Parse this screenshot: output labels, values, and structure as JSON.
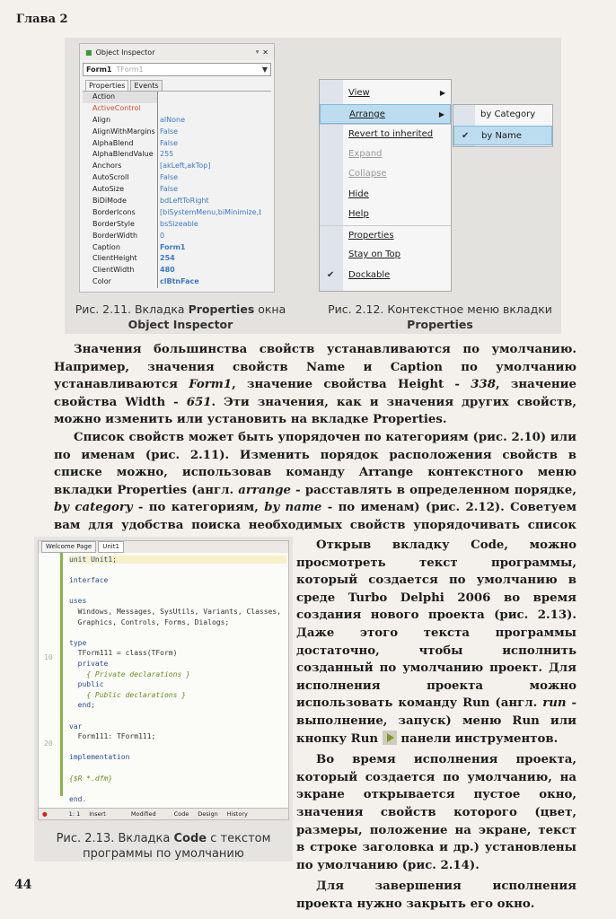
{
  "header": {
    "chapter": "Глава 2"
  },
  "fig211": {
    "window_title": "Object Inspector",
    "pin": "ᵠ",
    "close": "✕",
    "object": "Form1",
    "object_type": "TForm1",
    "tabs": [
      "Properties",
      "Events"
    ],
    "properties": [
      {
        "name": "Action",
        "value": ""
      },
      {
        "name": "ActiveControl",
        "value": ""
      },
      {
        "name": "Align",
        "value": "alNone"
      },
      {
        "name": "AlignWithMargins",
        "value": "False"
      },
      {
        "name": "AlphaBlend",
        "value": "False"
      },
      {
        "name": "AlphaBlendValue",
        "value": "255"
      },
      {
        "name": "Anchors",
        "value": "[akLeft,akTop]"
      },
      {
        "name": "AutoScroll",
        "value": "False"
      },
      {
        "name": "AutoSize",
        "value": "False"
      },
      {
        "name": "BiDiMode",
        "value": "bdLeftToRight"
      },
      {
        "name": "BorderIcons",
        "value": "[biSystemMenu,biMinimize,biMa"
      },
      {
        "name": "BorderStyle",
        "value": "bsSizeable"
      },
      {
        "name": "BorderWidth",
        "value": "0"
      },
      {
        "name": "Caption",
        "value": "Form1"
      },
      {
        "name": "ClientHeight",
        "value": "254"
      },
      {
        "name": "ClientWidth",
        "value": "480"
      },
      {
        "name": "Color",
        "value": "clBtnFace"
      }
    ],
    "caption_a": "Рис. 2.11. Вкладка ",
    "caption_b": "Properties",
    "caption_c": " окна",
    "caption_d": "Object Inspector"
  },
  "fig212": {
    "items": [
      "View",
      "Arrange",
      "Revert to inherited",
      "Expand",
      "Collapse",
      "Hide",
      "Help",
      "Properties",
      "Stay on Top",
      "Dockable"
    ],
    "submenu": [
      "by Category",
      "by Name"
    ],
    "check": "✔",
    "arrow": "▶",
    "caption_a": "Рис. 2.12. Контекстное меню вкладки",
    "caption_b": "Properties"
  },
  "text": {
    "p1": [
      "Значения большинства свойств устанавливаются по умолчанию. Например, значения свойств Name и Caption по умолчанию устанавливаются ",
      "Form1",
      ", значение свойства Height - ",
      "338",
      ", значение свойства Width - ",
      "651",
      ". Эти значения, как и значения других свойств, можно изменить или установить на вкладке Properties."
    ],
    "p2": [
      "Список свойств может быть упорядочен по категориям (рис. 2.10) или по именам (рис. 2.11). Изменить порядок расположения свойств в списке можно, использовав команду Arrange контекстного меню вкладки Properties (англ. ",
      "arrange",
      " - расставлять в определенном порядке, ",
      "by category",
      " - по категориям, ",
      "by name",
      " - по именам) (рис. 2.12). Советуем вам для удобства поиска необходимых свойств упорядочивать список свойств по именам."
    ],
    "p3": [
      "Открыв вкладку Code, можно просмотреть текст программы, который создается по умолчанию в среде Turbo Delphi 2006 во время создания нового проекта (рис. 2.13). Даже этого текста программы достаточно, чтобы исполнить созданный по умолчанию проект. Для исполнения проекта можно использовать команду Run (англ. ",
      "run",
      " - выполнение, запуск) меню Run или кнопку Run ",
      "панели инструментов."
    ],
    "p4": "Во время исполнения проекта, который создается по умолчанию, на экране открывается пустое окно, значения свойств которого (цвет, размеры, положение на экране, текст в строке заголовка и др.) установлены по умолчанию (рис. 2.14).",
    "p5": "Для завершения исполнения проекта нужно закрыть его окно."
  },
  "fig213": {
    "tabs": [
      "Welcome Page",
      "Unit1"
    ],
    "code": [
      "unit Unit1;",
      "",
      "interface",
      "",
      "uses",
      "  Windows, Messages, SysUtils, Variants, Classes,",
      "  Graphics, Controls, Forms, Dialogs;",
      "",
      "type",
      "  TForm111 = class(TForm)",
      "  private",
      "    { Private declarations }",
      "  public",
      "    { Public declarations }",
      "  end;",
      "",
      "var",
      "  Form111: TForm111;",
      "",
      "implementation",
      "",
      "{$R *.dfm}",
      "",
      "end."
    ],
    "line_numbers": [
      "10",
      "20"
    ],
    "status": {
      "pos": "1: 1",
      "mode": "Insert",
      "state": "Modified",
      "views": [
        "Code",
        "Design",
        "History"
      ]
    },
    "caption_a": "Рис. 2.13. Вкладка ",
    "caption_b": "Code",
    "caption_c": " с текстом",
    "caption_d": "программы по умолчанию"
  },
  "footer": {
    "page": "44"
  }
}
